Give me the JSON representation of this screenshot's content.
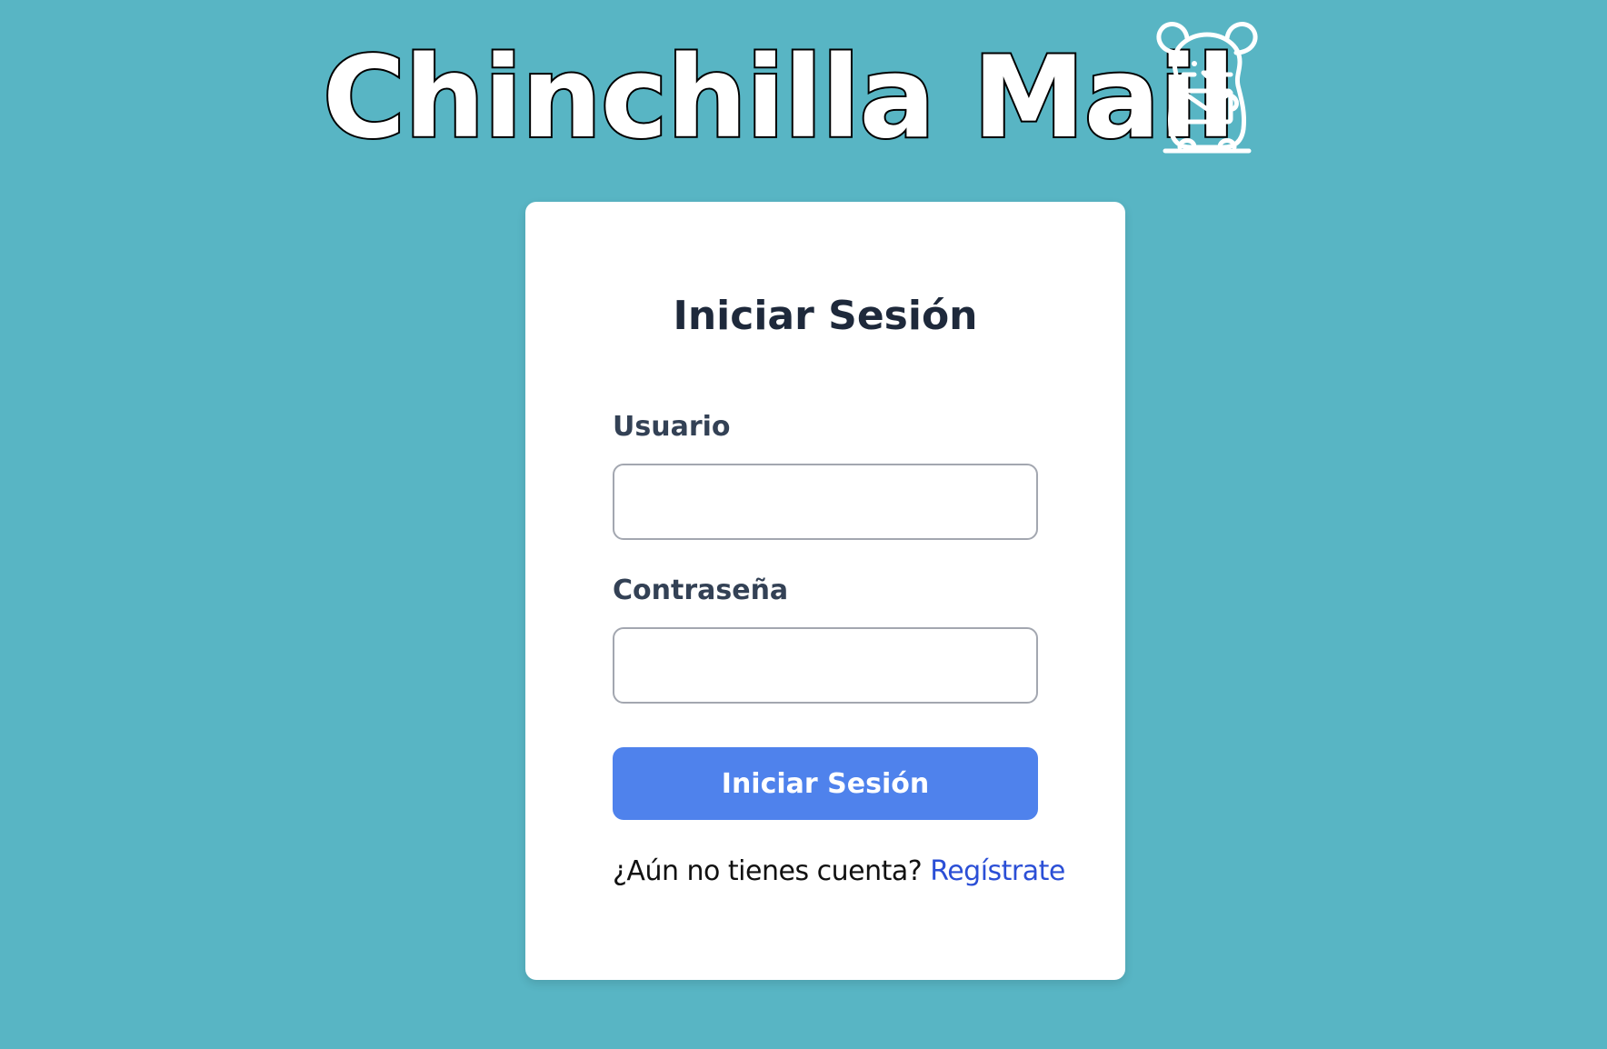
{
  "brand": {
    "title": "Chinchilla Mail",
    "logo_icon": "chinchilla-mail-icon"
  },
  "login": {
    "heading": "Iniciar Sesión",
    "username_label": "Usuario",
    "username_value": "",
    "password_label": "Contraseña",
    "password_value": "",
    "submit_label": "Iniciar Sesión",
    "register_prompt": "¿Aún no tienes cuenta?",
    "register_link": "Regístrate"
  },
  "colors": {
    "background": "#58b5c4",
    "card": "#ffffff",
    "button": "#4f82ec",
    "link": "#2b4fd6",
    "heading_text": "#1e293b"
  }
}
